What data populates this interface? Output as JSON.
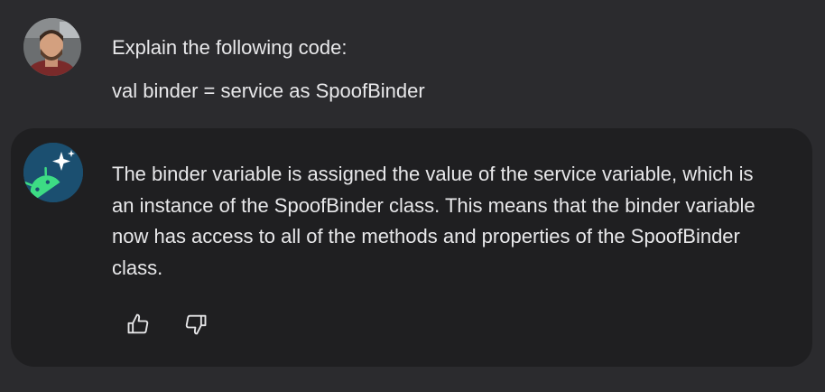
{
  "user_message": {
    "avatar_icon": "user-photo-avatar",
    "lines": [
      "Explain the following code:",
      "val binder = service as SpoofBinder"
    ]
  },
  "assistant_message": {
    "avatar_icon": "android-sparkle-bot-avatar",
    "text": "The binder variable is assigned the value of the service variable, which is an instance of the SpoofBinder class. This means that the binder variable now has access to all of the methods and properties of the SpoofBinder class.",
    "actions": {
      "thumbs_up_icon": "thumbs-up-icon",
      "thumbs_down_icon": "thumbs-down-icon"
    }
  },
  "colors": {
    "background": "#2b2b2e",
    "card_background": "#1f1f21",
    "text": "#e8e8ea",
    "bot_avatar_bg": "#1b4f70",
    "android_green": "#3ddc84"
  }
}
